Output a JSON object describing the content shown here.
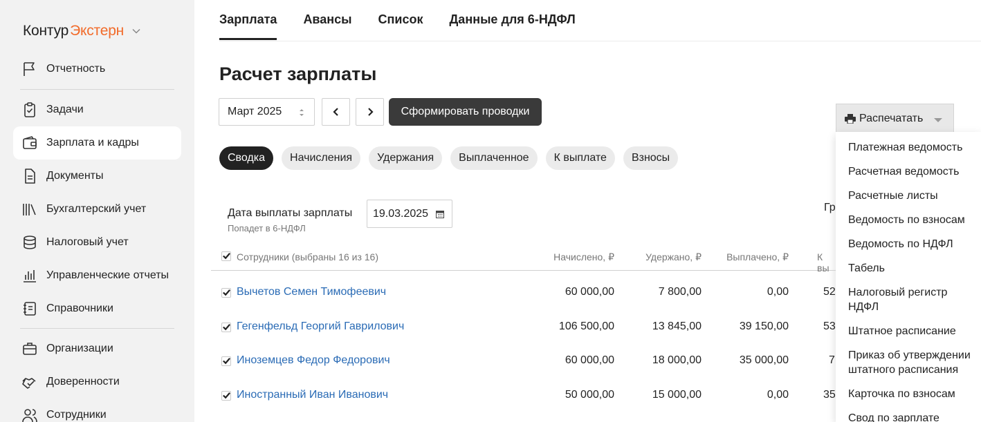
{
  "logo": {
    "part1": "Контур",
    "part2": "Экстерн"
  },
  "sidebar": {
    "items": [
      {
        "label": "Отчетность",
        "icon": "flag-icon"
      },
      {
        "label": "Задачи",
        "icon": "clipboard-check-icon"
      },
      {
        "label": "Зарплата и кадры",
        "icon": "wallet-icon",
        "active": true
      },
      {
        "label": "Документы",
        "icon": "document-icon"
      },
      {
        "label": "Бухгалтерский учет",
        "icon": "books-icon"
      },
      {
        "label": "Налоговый учет",
        "icon": "coins-stack-icon"
      },
      {
        "label": "Управленческие отчеты",
        "icon": "bar-chart-icon"
      },
      {
        "label": "Справочники",
        "icon": "notebook-icon"
      },
      {
        "label": "Организации",
        "icon": "briefcase-icon"
      },
      {
        "label": "Доверенности",
        "icon": "handshake-icon"
      },
      {
        "label": "Сотрудники",
        "icon": "users-icon"
      }
    ]
  },
  "top_tabs": [
    {
      "label": "Зарплата",
      "active": true
    },
    {
      "label": "Авансы"
    },
    {
      "label": "Список"
    },
    {
      "label": "Данные для 6-НДФЛ"
    }
  ],
  "page_title": "Расчет зарплаты",
  "controls": {
    "month_value": "Март 2025",
    "primary_button": "Сформировать проводки",
    "print_button": "Распечатать"
  },
  "print_menu": [
    "Платежная ведомость",
    "Расчетная ведомость",
    "Расчетные листы",
    "Ведомость по взносам",
    "Ведомость по НДФЛ",
    "Табель",
    "Налоговый регистр НДФЛ",
    "Штатное расписание",
    "Приказ об утверждении штатного расписания",
    "Карточка по взносам",
    "Свод по зарплате"
  ],
  "pills": [
    {
      "label": "Сводка",
      "active": true
    },
    {
      "label": "Начисления"
    },
    {
      "label": "Удержания"
    },
    {
      "label": "Выплаченное"
    },
    {
      "label": "К выплате"
    },
    {
      "label": "Взносы"
    }
  ],
  "pay_date": {
    "label": "Дата выплаты зарплаты",
    "sub": "Попадет в 6-НДФЛ",
    "value": "19.03.2025"
  },
  "partial_right_text": "Гр",
  "table": {
    "headers": {
      "employees": "Сотрудники (выбраны 16 из 16)",
      "accrued": "Начислено, ₽",
      "withheld": "Удержано, ₽",
      "paid": "Выплачено, ₽",
      "to_pay": "К вы"
    },
    "rows": [
      {
        "name": "Вычетов Семен Тимофеевич",
        "accrued": "60 000,00",
        "withheld": "7 800,00",
        "paid": "0,00",
        "to_pay": "52"
      },
      {
        "name": "Гегенфельд Георгий Гаврилович",
        "accrued": "106 500,00",
        "withheld": "13 845,00",
        "paid": "39 150,00",
        "to_pay": "53"
      },
      {
        "name": "Иноземцев Федор Федорович",
        "accrued": "60 000,00",
        "withheld": "18 000,00",
        "paid": "35 000,00",
        "to_pay": "7"
      },
      {
        "name": "Иностранный Иван Иванович",
        "accrued": "50 000,00",
        "withheld": "15 000,00",
        "paid": "0,00",
        "to_pay": "35"
      }
    ]
  },
  "colors": {
    "accent_orange": "#f26b2a",
    "link_blue": "#2a6bb5",
    "dark_button": "#3a3a3a",
    "sidebar_bg": "#f2f2f2"
  }
}
